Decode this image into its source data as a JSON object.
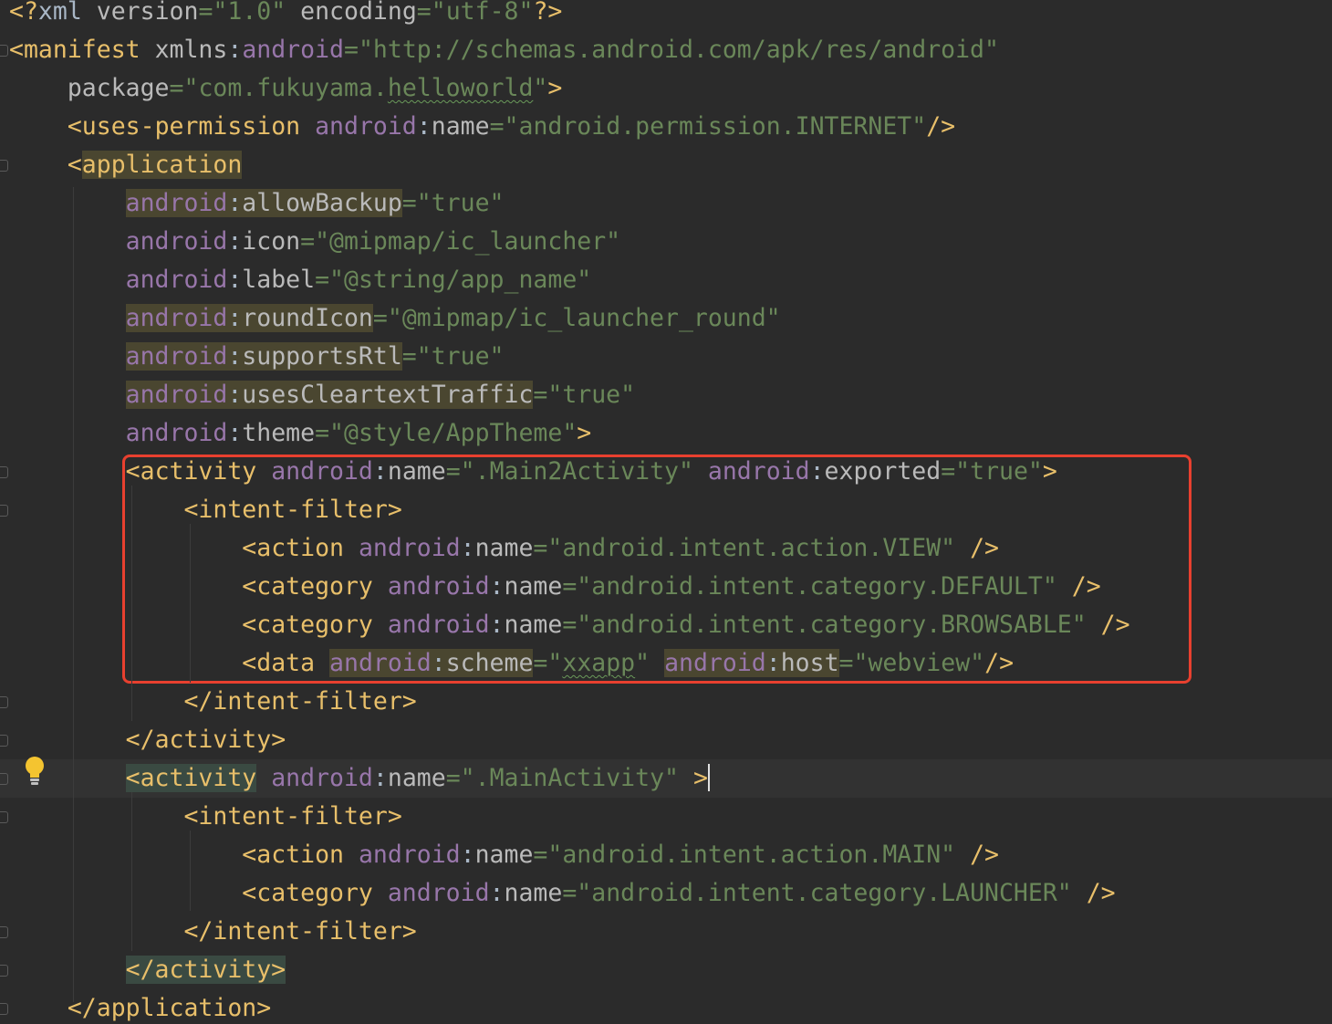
{
  "editor": {
    "file_type": "xml",
    "lines": [
      {
        "tokens": [
          [
            "<?",
            "punct"
          ],
          [
            "xml ",
            "text"
          ],
          [
            "version",
            "attr"
          ],
          [
            "=",
            "eq"
          ],
          [
            "\"1.0\" ",
            "str"
          ],
          [
            "encoding",
            "attr"
          ],
          [
            "=",
            "eq"
          ],
          [
            "\"utf-8\"",
            "str"
          ],
          [
            "?>",
            "punct"
          ]
        ]
      },
      {
        "tokens": [
          [
            "<",
            "punct"
          ],
          [
            "manifest ",
            "tag"
          ],
          [
            "xmlns",
            "attr"
          ],
          [
            ":",
            "text"
          ],
          [
            "android",
            "ns"
          ],
          [
            "=",
            "eq"
          ],
          [
            "\"http://schemas.android.com/apk/res/android\"",
            "str"
          ]
        ]
      },
      {
        "tokens": [
          [
            "    ",
            "text"
          ],
          [
            "package",
            "attr"
          ],
          [
            "=",
            "eq"
          ],
          [
            "\"com.fukuyama.",
            "str"
          ],
          [
            "helloworld",
            "str-typo"
          ],
          [
            "\"",
            "str"
          ],
          [
            ">",
            "punct"
          ]
        ]
      },
      {
        "tokens": [
          [
            "    ",
            "text"
          ],
          [
            "<",
            "punct"
          ],
          [
            "uses-permission ",
            "tag"
          ],
          [
            "android",
            "ns"
          ],
          [
            ":",
            "text"
          ],
          [
            "name",
            "attr"
          ],
          [
            "=",
            "eq"
          ],
          [
            "\"android.permission.INTERNET\"",
            "str"
          ],
          [
            "/>",
            "punct"
          ]
        ]
      },
      {
        "tokens": [
          [
            "    ",
            "text"
          ],
          [
            "<",
            "punct"
          ],
          [
            "application",
            "tag-hl-attr"
          ]
        ]
      },
      {
        "tokens": [
          [
            "        ",
            "text"
          ],
          [
            "android",
            "ns-hl"
          ],
          [
            ":",
            "text-hl"
          ],
          [
            "allowBackup",
            "attr-hl"
          ],
          [
            "=",
            "eq"
          ],
          [
            "\"true\"",
            "str"
          ]
        ]
      },
      {
        "tokens": [
          [
            "        ",
            "text"
          ],
          [
            "android",
            "ns"
          ],
          [
            ":",
            "text"
          ],
          [
            "icon",
            "attr"
          ],
          [
            "=",
            "eq"
          ],
          [
            "\"@mipmap/ic_launcher\"",
            "str"
          ]
        ]
      },
      {
        "tokens": [
          [
            "        ",
            "text"
          ],
          [
            "android",
            "ns"
          ],
          [
            ":",
            "text"
          ],
          [
            "label",
            "attr"
          ],
          [
            "=",
            "eq"
          ],
          [
            "\"@string/app_name\"",
            "str"
          ]
        ]
      },
      {
        "tokens": [
          [
            "        ",
            "text"
          ],
          [
            "android",
            "ns-hl"
          ],
          [
            ":",
            "text-hl"
          ],
          [
            "roundIcon",
            "attr-hl"
          ],
          [
            "=",
            "eq"
          ],
          [
            "\"@mipmap/ic_launcher_round\"",
            "str"
          ]
        ]
      },
      {
        "tokens": [
          [
            "        ",
            "text"
          ],
          [
            "android",
            "ns-hl"
          ],
          [
            ":",
            "text-hl"
          ],
          [
            "supportsRtl",
            "attr-hl"
          ],
          [
            "=",
            "eq"
          ],
          [
            "\"true\"",
            "str"
          ]
        ]
      },
      {
        "tokens": [
          [
            "        ",
            "text"
          ],
          [
            "android",
            "ns-hl"
          ],
          [
            ":",
            "text-hl"
          ],
          [
            "usesCleartextTraffic",
            "attr-hl"
          ],
          [
            "=",
            "eq"
          ],
          [
            "\"true\"",
            "str"
          ]
        ]
      },
      {
        "tokens": [
          [
            "        ",
            "text"
          ],
          [
            "android",
            "ns"
          ],
          [
            ":",
            "text"
          ],
          [
            "theme",
            "attr"
          ],
          [
            "=",
            "eq"
          ],
          [
            "\"@style/AppTheme\"",
            "str"
          ],
          [
            ">",
            "punct"
          ]
        ]
      },
      {
        "tokens": [
          [
            "        ",
            "text"
          ],
          [
            "<",
            "punct"
          ],
          [
            "activity ",
            "tag"
          ],
          [
            "android",
            "ns"
          ],
          [
            ":",
            "text"
          ],
          [
            "name",
            "attr"
          ],
          [
            "=",
            "eq"
          ],
          [
            "\".Main2Activity\" ",
            "str"
          ],
          [
            "android",
            "ns"
          ],
          [
            ":",
            "text"
          ],
          [
            "exported",
            "attr"
          ],
          [
            "=",
            "eq"
          ],
          [
            "\"true\"",
            "str"
          ],
          [
            ">",
            "punct"
          ]
        ]
      },
      {
        "tokens": [
          [
            "            ",
            "text"
          ],
          [
            "<",
            "punct"
          ],
          [
            "intent-filter",
            "tag"
          ],
          [
            ">",
            "punct"
          ]
        ]
      },
      {
        "tokens": [
          [
            "                ",
            "text"
          ],
          [
            "<",
            "punct"
          ],
          [
            "action ",
            "tag"
          ],
          [
            "android",
            "ns"
          ],
          [
            ":",
            "text"
          ],
          [
            "name",
            "attr"
          ],
          [
            "=",
            "eq"
          ],
          [
            "\"android.intent.action.VIEW\" ",
            "str"
          ],
          [
            "/>",
            "punct"
          ]
        ]
      },
      {
        "tokens": [
          [
            "                ",
            "text"
          ],
          [
            "<",
            "punct"
          ],
          [
            "category ",
            "tag"
          ],
          [
            "android",
            "ns"
          ],
          [
            ":",
            "text"
          ],
          [
            "name",
            "attr"
          ],
          [
            "=",
            "eq"
          ],
          [
            "\"android.intent.category.DEFAULT\" ",
            "str"
          ],
          [
            "/>",
            "punct"
          ]
        ]
      },
      {
        "tokens": [
          [
            "                ",
            "text"
          ],
          [
            "<",
            "punct"
          ],
          [
            "category ",
            "tag"
          ],
          [
            "android",
            "ns"
          ],
          [
            ":",
            "text"
          ],
          [
            "name",
            "attr"
          ],
          [
            "=",
            "eq"
          ],
          [
            "\"android.intent.category.BROWSABLE\" ",
            "str"
          ],
          [
            "/>",
            "punct"
          ]
        ]
      },
      {
        "tokens": [
          [
            "                ",
            "text"
          ],
          [
            "<",
            "punct"
          ],
          [
            "data ",
            "tag"
          ],
          [
            "android",
            "ns-hl"
          ],
          [
            ":",
            "text-hl"
          ],
          [
            "scheme",
            "attr-hl"
          ],
          [
            "=",
            "eq"
          ],
          [
            "\"",
            "str"
          ],
          [
            "xxapp",
            "str-typo"
          ],
          [
            "\" ",
            "str"
          ],
          [
            "android",
            "ns-hl"
          ],
          [
            ":",
            "text-hl"
          ],
          [
            "host",
            "attr-hl"
          ],
          [
            "=",
            "eq"
          ],
          [
            "\"webview\"",
            "str"
          ],
          [
            "/>",
            "punct"
          ]
        ]
      },
      {
        "tokens": [
          [
            "            ",
            "text"
          ],
          [
            "</",
            "punct"
          ],
          [
            "intent-filter",
            "tag"
          ],
          [
            ">",
            "punct"
          ]
        ]
      },
      {
        "tokens": [
          [
            "        ",
            "text"
          ],
          [
            "</",
            "punct"
          ],
          [
            "activity",
            "tag"
          ],
          [
            ">",
            "punct"
          ]
        ]
      },
      {
        "current": true,
        "tokens": [
          [
            "        ",
            "text"
          ],
          [
            "<activity",
            "tag-hl-tag"
          ],
          [
            " ",
            "text"
          ],
          [
            "android",
            "ns"
          ],
          [
            ":",
            "text"
          ],
          [
            "name",
            "attr"
          ],
          [
            "=",
            "eq"
          ],
          [
            "\".MainActivity\" ",
            "str"
          ],
          [
            ">",
            "punct"
          ]
        ]
      },
      {
        "tokens": [
          [
            "            ",
            "text"
          ],
          [
            "<",
            "punct"
          ],
          [
            "intent-filter",
            "tag"
          ],
          [
            ">",
            "punct"
          ]
        ]
      },
      {
        "tokens": [
          [
            "                ",
            "text"
          ],
          [
            "<",
            "punct"
          ],
          [
            "action ",
            "tag"
          ],
          [
            "android",
            "ns"
          ],
          [
            ":",
            "text"
          ],
          [
            "name",
            "attr"
          ],
          [
            "=",
            "eq"
          ],
          [
            "\"android.intent.action.MAIN\" ",
            "str"
          ],
          [
            "/>",
            "punct"
          ]
        ]
      },
      {
        "tokens": [
          [
            "                ",
            "text"
          ],
          [
            "<",
            "punct"
          ],
          [
            "category ",
            "tag"
          ],
          [
            "android",
            "ns"
          ],
          [
            ":",
            "text"
          ],
          [
            "name",
            "attr"
          ],
          [
            "=",
            "eq"
          ],
          [
            "\"android.intent.category.LAUNCHER\" ",
            "str"
          ],
          [
            "/>",
            "punct"
          ]
        ]
      },
      {
        "tokens": [
          [
            "            ",
            "text"
          ],
          [
            "</",
            "punct"
          ],
          [
            "intent-filter",
            "tag"
          ],
          [
            ">",
            "punct"
          ]
        ]
      },
      {
        "tokens": [
          [
            "        ",
            "text"
          ],
          [
            "</activity>",
            "tag-hl-tag"
          ]
        ]
      },
      {
        "tokens": [
          [
            "    ",
            "text"
          ],
          [
            "</",
            "punct"
          ],
          [
            "application",
            "tag"
          ],
          [
            ">",
            "punct"
          ]
        ]
      }
    ]
  },
  "colors": {
    "background": "#2b2b2b",
    "current_line": "#323232",
    "tag": "#e8bf6a",
    "namespace": "#9876aa",
    "attribute": "#bababa",
    "string": "#6a8759",
    "annotation_box": "#e8402f"
  },
  "gutter": {
    "intention_icon": "lightbulb-icon"
  }
}
